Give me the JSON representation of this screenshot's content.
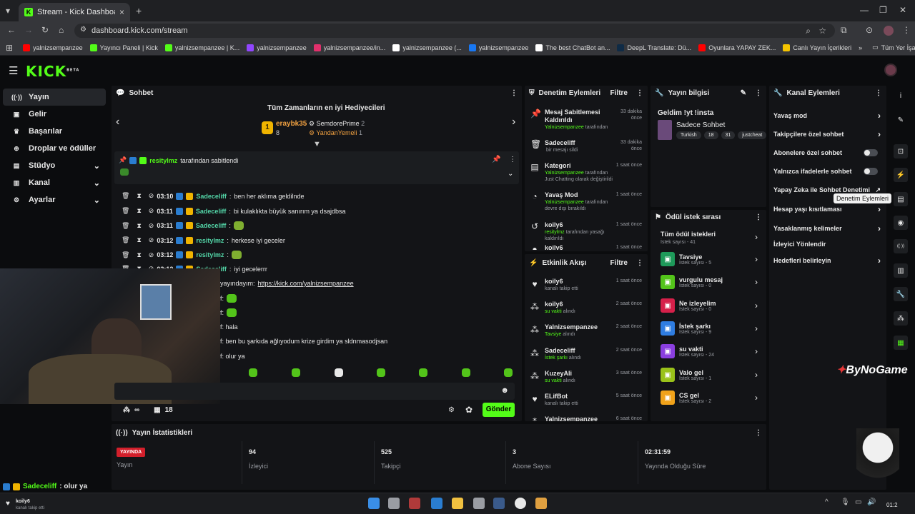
{
  "browser": {
    "tab_title": "Stream - Kick Dashboard",
    "url": "dashboard.kick.com/stream",
    "bookmarks": [
      {
        "label": "yalnizsempanzee",
        "color": "#ff0000"
      },
      {
        "label": "Yayıncı Paneli | Kick",
        "color": "#53fc18"
      },
      {
        "label": "yalnizsempanzee | K...",
        "color": "#53fc18"
      },
      {
        "label": "yalnizsempanzee",
        "color": "#9146ff"
      },
      {
        "label": "yalnizsempanzee/in...",
        "color": "#e1306c"
      },
      {
        "label": "yalnizsempanzee (...",
        "color": "#ffffff"
      },
      {
        "label": "yalnizsempanzee",
        "color": "#1877f2"
      },
      {
        "label": "The best ChatBot an...",
        "color": "#ffffff"
      },
      {
        "label": "DeepL Translate: Dü...",
        "color": "#0f2b46"
      },
      {
        "label": "Oyunlara YAPAY ZEK...",
        "color": "#ff0000"
      },
      {
        "label": "Canlı Yayın İçerikleri",
        "color": "#f5c400"
      }
    ],
    "all_bookmarks": "Tüm Yer İşaretleri"
  },
  "brand": {
    "logo": "KICK",
    "beta": "BETA",
    "accent": "#53fc18"
  },
  "sidebar": [
    {
      "label": "Yayın",
      "icon": "broadcast-icon",
      "active": true
    },
    {
      "label": "Gelir",
      "icon": "money-icon"
    },
    {
      "label": "Başarılar",
      "icon": "trophy-icon"
    },
    {
      "label": "Droplar ve ödüller",
      "icon": "gift-icon"
    },
    {
      "label": "Stüdyo",
      "icon": "studio-icon",
      "chevron": true
    },
    {
      "label": "Kanal",
      "icon": "channel-icon",
      "chevron": true
    },
    {
      "label": "Ayarlar",
      "icon": "settings-icon",
      "chevron": true
    }
  ],
  "chat": {
    "title": "Sohbet",
    "gifters_title": "Tüm Zamanların en iyi Hediyecileri",
    "gifters": [
      {
        "name": "eraybk35",
        "count": "8"
      },
      {
        "name": "SemdorePrime",
        "count": "2"
      },
      {
        "name": "YandanYemeli",
        "count": "1"
      }
    ],
    "pinned_by": "resitylmz",
    "pinned_text": "tarafından sabitlendi",
    "messages": [
      {
        "time": "03:10",
        "user": "Sadeceliff",
        "text": "ben her aklıma geldilnde"
      },
      {
        "time": "03:11",
        "user": "Sadeceliff",
        "text": "bi kulaklıkta büyük sanırım ya dsajdbsa"
      },
      {
        "time": "03:11",
        "user": "Sadeceliff",
        "text": ""
      },
      {
        "time": "03:12",
        "user": "resitylmz",
        "text": "herkese iyi geceler"
      },
      {
        "time": "03:12",
        "user": "resitylmz",
        "text": ""
      },
      {
        "time": "03:12",
        "user": "Sadeceliff",
        "text": "iyi gecelerrr"
      }
    ],
    "partial_lines": [
      {
        "text": "yayındayım: ",
        "link": "https://kick.com/yalnizsempanzee"
      },
      {
        "text": "f:",
        "link": ""
      },
      {
        "text": "f:",
        "link": ""
      },
      {
        "text": "f: hala",
        "link": ""
      },
      {
        "text": "f: ben bu şarkıda ağlıyodum krize girdim ya sldnmasodjsan",
        "link": ""
      },
      {
        "text": "f: olur ya",
        "link": ""
      }
    ],
    "viewer_count": "∞",
    "slow_count": "18",
    "send_label": "Gönder"
  },
  "overlay_chat": {
    "user": "Sadeceliff",
    "text": ": olur ya"
  },
  "follow_notice": {
    "user": "koily6",
    "text": "kanalı takip etti"
  },
  "mod_actions": {
    "title": "Denetim Eylemleri",
    "filter": "Filtre",
    "items": [
      {
        "icon": "pin-icon",
        "title": "Mesaj Sabitlemesi Kaldırıldı",
        "actor": "Yalnizsempanzee",
        "desc": "tarafından",
        "time": "33 dakika önce"
      },
      {
        "icon": "trash-icon",
        "title": "Sadeceliff",
        "actor": "",
        "desc": "bir mesajı sildi",
        "time": "33 dakika önce"
      },
      {
        "icon": "category-icon",
        "title": "Kategori",
        "actor": "Yalnizsempanzee",
        "desc": "tarafından Just Chatting olarak değiştirildi",
        "time": "1 saat önce"
      },
      {
        "icon": "slow-mode-icon",
        "title": "Yavaş Mod",
        "actor": "Yalnizsempanzee",
        "desc": "tarafından devre dışı bırakıldı",
        "time": "1 saat önce"
      },
      {
        "icon": "unban-icon",
        "title": "koily6",
        "actor": "resitylmz",
        "desc": "tarafından yasağı kaldırıldı",
        "time": "1 saat önce"
      },
      {
        "icon": "user-icon",
        "title": "koily6",
        "actor": "",
        "desc": "",
        "time": "1 saat önce"
      }
    ]
  },
  "activity": {
    "title": "Etkinlik Akışı",
    "filter": "Filtre",
    "items": [
      {
        "icon": "heart-icon",
        "user": "koily6",
        "desc": "kanalı takip etti",
        "hl": "",
        "time": "1 saat önce"
      },
      {
        "icon": "points-icon",
        "user": "koily6",
        "desc": " alındı",
        "hl": "su vakti",
        "time": "2 saat önce"
      },
      {
        "icon": "points-icon",
        "user": "Yalnizsempanzee",
        "desc": " alındı",
        "hl": "Tavsiye",
        "time": "2 saat önce"
      },
      {
        "icon": "points-icon",
        "user": "Sadeceliff",
        "desc": " alındı",
        "hl": "İstek şarkı",
        "time": "2 saat önce"
      },
      {
        "icon": "points-icon",
        "user": "KuzeyAli",
        "desc": " alındı",
        "hl": "su vakti",
        "time": "3 saat önce"
      },
      {
        "icon": "heart-icon",
        "user": "ELifBot",
        "desc": "kanalı takip etti",
        "hl": "",
        "time": "5 saat önce"
      },
      {
        "icon": "points-icon",
        "user": "Yalnizsempanzee",
        "desc": "",
        "hl": "",
        "time": "6 saat önce"
      }
    ]
  },
  "stream_info": {
    "title": "Yayın bilgisi",
    "stream_title": "Geldim !yt !insta",
    "category": "Sadece Sohbet",
    "tags": [
      "Turkish",
      "18",
      "31",
      "justcheat"
    ]
  },
  "rewards": {
    "title": "Ödül istek sırası",
    "all_label": "Tüm ödül istekleri",
    "all_count": "İstek sayısı - 41",
    "items": [
      {
        "name": "Tavsiye",
        "count": "İstek sayısı - 5",
        "color": "#1e9a5a"
      },
      {
        "name": "vurgulu mesaj",
        "count": "İstek sayısı - 0",
        "color": "#53c41a"
      },
      {
        "name": "Ne izleyelim",
        "count": "İstek sayısı - 0",
        "color": "#d6204a"
      },
      {
        "name": "İstek şarkı",
        "count": "İstek sayısı - 9",
        "color": "#2f7de1"
      },
      {
        "name": "su vakti",
        "count": "İstek sayısı - 24",
        "color": "#8a3fe0"
      },
      {
        "name": "Valo gel",
        "count": "İstek sayısı - 1",
        "color": "#9ac21a"
      },
      {
        "name": "CS gel",
        "count": "İstek sayısı - 2",
        "color": "#f0a21a"
      }
    ]
  },
  "channel_actions": {
    "title": "Kanal Eylemleri",
    "items": [
      {
        "label": "Yavaş mod",
        "kind": "chevron"
      },
      {
        "label": "Takipçilere özel sohbet",
        "kind": "chevron"
      },
      {
        "label": "Abonelere özel sohbet",
        "kind": "toggle"
      },
      {
        "label": "Yalnızca ifadelerle sohbet",
        "kind": "toggle"
      },
      {
        "label": "Yapay Zeka ile Sohbet Denetimi",
        "kind": "external"
      },
      {
        "label": "Hesap yaşı kısıtlaması",
        "kind": "chevron"
      },
      {
        "label": "Yasaklanmış kelimeler",
        "kind": "chevron"
      },
      {
        "label": "İzleyici Yönlendir",
        "kind": "none"
      },
      {
        "label": "Hedefleri belirleyin",
        "kind": "chevron"
      }
    ],
    "tooltip": "Denetim Eylemleri"
  },
  "stats": {
    "title": "Yayın İstatistikleri",
    "live_badge": "YAYINDA",
    "items": [
      {
        "value": "",
        "label": "Yayın"
      },
      {
        "value": "94",
        "label": "İzleyici"
      },
      {
        "value": "525",
        "label": "Takipçi"
      },
      {
        "value": "3",
        "label": "Abone Sayısı"
      },
      {
        "value": "02:31:59",
        "label": "Yayında Olduğu Süre"
      }
    ]
  },
  "watermark": "ByNoGame",
  "clock": "01:2"
}
